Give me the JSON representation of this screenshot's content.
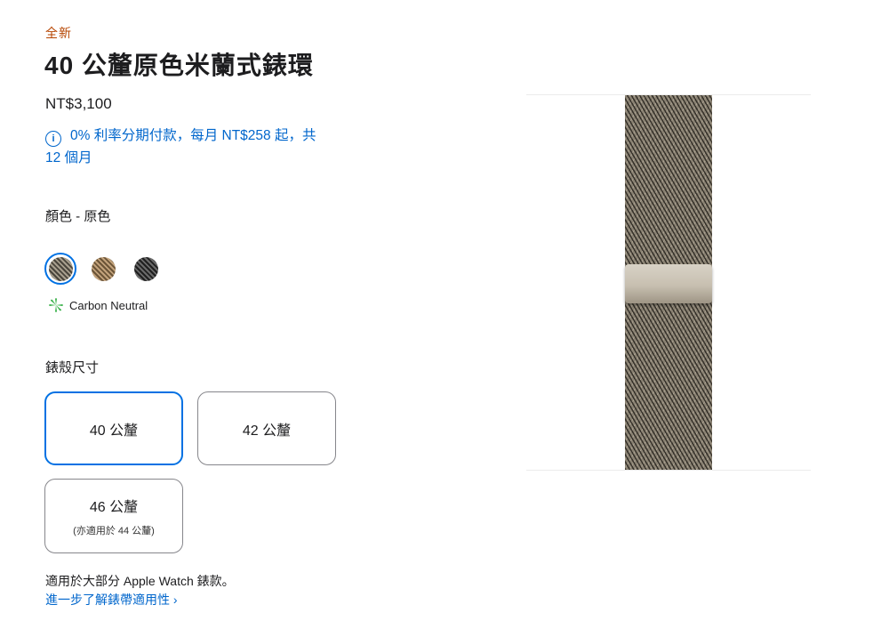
{
  "product": {
    "badge": "全新",
    "title": "40 公釐原色米蘭式錶環",
    "price": "NT$3,100",
    "financing_line1": "0% 利率分期付款，每月 NT$258 起，共",
    "financing_line2": "12 個月"
  },
  "color": {
    "label": "顏色 - 原色",
    "swatches": [
      {
        "name": "natural",
        "selected": true,
        "color": "#8a8273"
      },
      {
        "name": "gold",
        "selected": false,
        "color": "#a9865e"
      },
      {
        "name": "slate",
        "selected": false,
        "color": "#3c3c3c"
      }
    ]
  },
  "carbon_neutral": {
    "label": "Carbon Neutral",
    "color": "#3fb34f"
  },
  "size": {
    "label": "錶殼尺寸",
    "options": [
      {
        "label": "40 公釐",
        "sub": "",
        "selected": true
      },
      {
        "label": "42 公釐",
        "sub": "",
        "selected": false
      },
      {
        "label": "46 公釐",
        "sub": "(亦適用於 44 公釐)",
        "selected": false
      }
    ]
  },
  "compat": {
    "note": "適用於大部分 Apple Watch 錶款。",
    "link": "進一步了解錶帶適用性"
  },
  "colors": {
    "accent": "#0071e3",
    "link": "#0066cc",
    "badge": "#b64400"
  }
}
